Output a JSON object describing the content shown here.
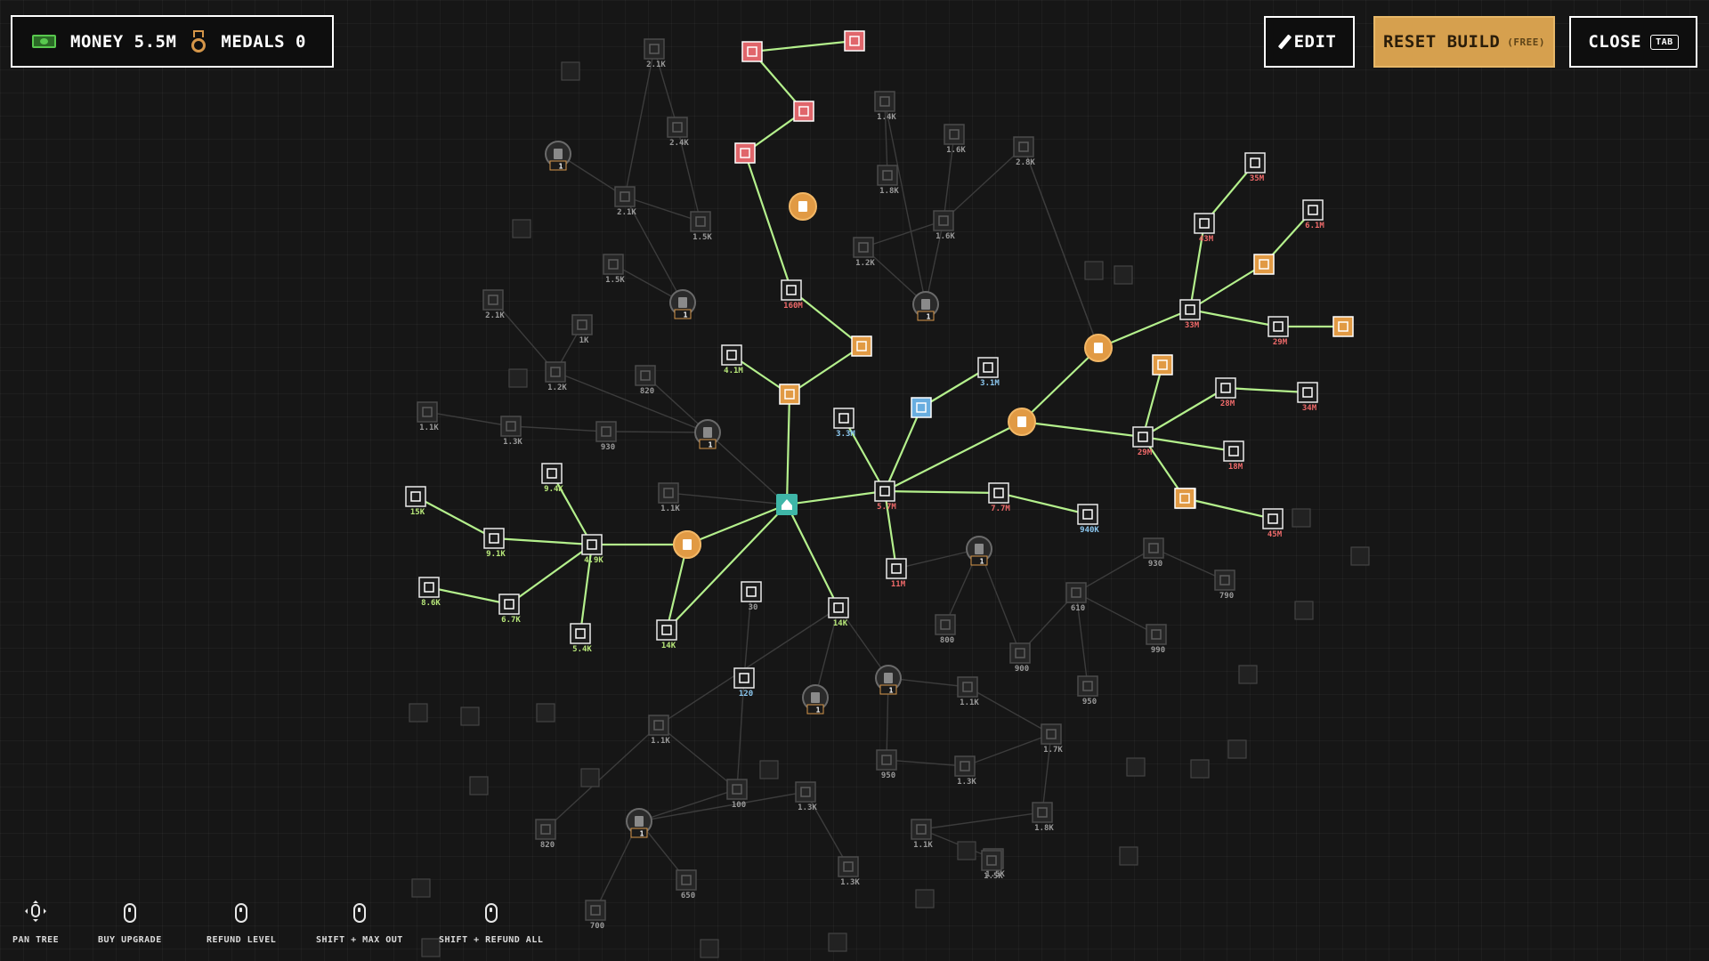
{
  "hud": {
    "money": "MONEY 5.5M",
    "medals": "MEDALS 0"
  },
  "buttons": {
    "edit": "EDIT",
    "reset": "RESET BUILD",
    "reset_sub": "(FREE)",
    "close": "CLOSE",
    "close_key": "TAB"
  },
  "controls": [
    {
      "label": "PAN TREE",
      "icon": "pan-icon"
    },
    {
      "label": "BUY UPGRADE",
      "icon": "mouse-left-icon"
    },
    {
      "label": "REFUND LEVEL",
      "icon": "mouse-right-icon"
    },
    {
      "label": "SHIFT + MAX OUT",
      "icon": "shift-mouse-left-icon"
    },
    {
      "label": "SHIFT + REFUND ALL",
      "icon": "shift-mouse-right-icon"
    }
  ],
  "colors": {
    "edge_active": "#b4f08c",
    "edge_dim": "#3c3c3c",
    "home": "#3fb6a8",
    "white_node": "#eaeaea",
    "orange_node": "#e19a44",
    "red_node": "#e0666b",
    "blue_node": "#69aee0",
    "green_node": "#b7e46c",
    "dim_node": "#4a4a4a"
  },
  "nodes": [
    {
      "id": "home",
      "kind": "home",
      "label": ""
    },
    {
      "id": "b1",
      "kind": "orange",
      "label": ""
    },
    {
      "id": "b2",
      "kind": "orange",
      "label": ""
    },
    {
      "id": "b3",
      "kind": "orange",
      "label": ""
    },
    {
      "id": "b4",
      "kind": "orange",
      "label": ""
    },
    {
      "id": "b5",
      "kind": "orange",
      "label": ""
    },
    {
      "id": "w1",
      "kind": "white",
      "label": "5.7M",
      "tone": "red"
    },
    {
      "id": "w2",
      "kind": "white",
      "label": "3.3M",
      "tone": "blue"
    },
    {
      "id": "w3",
      "kind": "blue",
      "label": ""
    },
    {
      "id": "w4",
      "kind": "white",
      "label": "3.1M",
      "tone": "blue"
    },
    {
      "id": "w5",
      "kind": "white",
      "label": "7.7M",
      "tone": "red"
    },
    {
      "id": "w6",
      "kind": "white",
      "label": "940K",
      "tone": "blue"
    },
    {
      "id": "w7",
      "kind": "white",
      "label": "11M",
      "tone": "red"
    },
    {
      "id": "w8",
      "kind": "white",
      "label": "14K",
      "tone": "green"
    },
    {
      "id": "w9",
      "kind": "orange_sq",
      "label": ""
    },
    {
      "id": "w10",
      "kind": "white",
      "label": "4.1M",
      "tone": "green"
    },
    {
      "id": "w11",
      "kind": "orange_sq",
      "label": ""
    },
    {
      "id": "w12",
      "kind": "white",
      "label": "160M",
      "tone": "red"
    },
    {
      "id": "w13",
      "kind": "red",
      "label": ""
    },
    {
      "id": "w14",
      "kind": "red",
      "label": ""
    },
    {
      "id": "w15",
      "kind": "red",
      "label": ""
    },
    {
      "id": "w16",
      "kind": "red",
      "label": ""
    },
    {
      "id": "w17",
      "kind": "white",
      "label": "29M",
      "tone": "red"
    },
    {
      "id": "w18",
      "kind": "white",
      "label": "28M",
      "tone": "red"
    },
    {
      "id": "w19",
      "kind": "white",
      "label": "34M",
      "tone": "red"
    },
    {
      "id": "w20",
      "kind": "white",
      "label": "18M",
      "tone": "red"
    },
    {
      "id": "w21",
      "kind": "orange_sq",
      "label": ""
    },
    {
      "id": "w22",
      "kind": "white",
      "label": "",
      "tone": ""
    },
    {
      "id": "w23",
      "kind": "white",
      "label": "45M",
      "tone": "red"
    },
    {
      "id": "w24",
      "kind": "white",
      "label": "33M",
      "tone": "red"
    },
    {
      "id": "w25",
      "kind": "white",
      "label": "43M",
      "tone": "red"
    },
    {
      "id": "w26",
      "kind": "white",
      "label": "35M",
      "tone": "red"
    },
    {
      "id": "w27",
      "kind": "orange_sq",
      "label": ""
    },
    {
      "id": "w28",
      "kind": "white",
      "label": "6.1M",
      "tone": "red"
    },
    {
      "id": "w29",
      "kind": "white",
      "label": "29M",
      "tone": "red"
    },
    {
      "id": "w30",
      "kind": "orange_sq",
      "label": ""
    },
    {
      "id": "w31",
      "kind": "orange_sq",
      "label": ""
    },
    {
      "id": "w32",
      "kind": "white",
      "label": "4.9K",
      "tone": "green"
    },
    {
      "id": "w33",
      "kind": "white",
      "label": "9.4K",
      "tone": "green"
    },
    {
      "id": "w34",
      "kind": "white",
      "label": "9.1K",
      "tone": "green"
    },
    {
      "id": "w35",
      "kind": "white",
      "label": "15K",
      "tone": "green"
    },
    {
      "id": "w36",
      "kind": "white",
      "label": "8.6K",
      "tone": "green"
    },
    {
      "id": "w37",
      "kind": "white",
      "label": "6.7K",
      "tone": "green"
    },
    {
      "id": "w38",
      "kind": "white",
      "label": "5.4K",
      "tone": "green"
    },
    {
      "id": "w39",
      "kind": "white",
      "label": "14K",
      "tone": "green"
    },
    {
      "id": "w40",
      "kind": "white",
      "label": "30",
      "tone": "dim"
    },
    {
      "id": "w41",
      "kind": "white",
      "label": "120",
      "tone": "blue"
    },
    {
      "id": "l1",
      "kind": "locked",
      "label": "1"
    },
    {
      "id": "l2",
      "kind": "locked",
      "label": "1"
    },
    {
      "id": "l3",
      "kind": "locked",
      "label": "1"
    },
    {
      "id": "l4",
      "kind": "locked",
      "label": "1"
    },
    {
      "id": "l5",
      "kind": "locked",
      "label": "1"
    },
    {
      "id": "l6",
      "kind": "locked",
      "label": "1"
    },
    {
      "id": "l7",
      "kind": "locked",
      "label": "1"
    },
    {
      "id": "l8",
      "kind": "locked",
      "label": "1"
    },
    {
      "id": "d1",
      "kind": "dim",
      "label": "2.1K"
    },
    {
      "id": "d2",
      "kind": "dim",
      "label": "2.4K"
    },
    {
      "id": "d3",
      "kind": "dim",
      "label": "1.4K"
    },
    {
      "id": "d4",
      "kind": "dim",
      "label": "1.8K"
    },
    {
      "id": "d5",
      "kind": "dim",
      "label": "1.6K"
    },
    {
      "id": "d6",
      "kind": "dim",
      "label": "2.8K"
    },
    {
      "id": "d7",
      "kind": "dim",
      "label": "1.2K"
    },
    {
      "id": "d8",
      "kind": "dim",
      "label": "1.6K"
    },
    {
      "id": "d9",
      "kind": "dim",
      "label": "2.1K"
    },
    {
      "id": "d10",
      "kind": "dim",
      "label": "1.5K"
    },
    {
      "id": "d11",
      "kind": "dim",
      "label": "1.5K"
    },
    {
      "id": "d12",
      "kind": "dim",
      "label": "2.1K"
    },
    {
      "id": "d13",
      "kind": "dim",
      "label": "1K"
    },
    {
      "id": "d14",
      "kind": "dim",
      "label": "1.2K"
    },
    {
      "id": "d15",
      "kind": "dim",
      "label": "820"
    },
    {
      "id": "d16",
      "kind": "dim",
      "label": "1.1K"
    },
    {
      "id": "d17",
      "kind": "dim",
      "label": "1.3K"
    },
    {
      "id": "d18",
      "kind": "dim",
      "label": "930"
    },
    {
      "id": "d19",
      "kind": "dim",
      "label": "1.1K"
    },
    {
      "id": "d20",
      "kind": "dim",
      "label": "800"
    },
    {
      "id": "d21",
      "kind": "dim",
      "label": "900"
    },
    {
      "id": "d22",
      "kind": "dim",
      "label": "610"
    },
    {
      "id": "d23",
      "kind": "dim",
      "label": "950"
    },
    {
      "id": "d24",
      "kind": "dim",
      "label": "990"
    },
    {
      "id": "d25",
      "kind": "dim",
      "label": "930"
    },
    {
      "id": "d26",
      "kind": "dim",
      "label": "790"
    },
    {
      "id": "d27",
      "kind": "dim",
      "label": "1.1K"
    },
    {
      "id": "d28",
      "kind": "dim",
      "label": "1.7K"
    },
    {
      "id": "d29",
      "kind": "dim",
      "label": "1.3K"
    },
    {
      "id": "d30",
      "kind": "dim",
      "label": "950"
    },
    {
      "id": "d31",
      "kind": "dim",
      "label": "1.8K"
    },
    {
      "id": "d32",
      "kind": "dim",
      "label": "1.1K"
    },
    {
      "id": "d33",
      "kind": "dim",
      "label": "1.5K"
    },
    {
      "id": "d34",
      "kind": "dim",
      "label": "1.1K"
    },
    {
      "id": "d35",
      "kind": "dim",
      "label": "100"
    },
    {
      "id": "d36",
      "kind": "dim",
      "label": "1.3K"
    },
    {
      "id": "d37",
      "kind": "dim",
      "label": "1.3K"
    },
    {
      "id": "d38",
      "kind": "dim",
      "label": "1.5K"
    },
    {
      "id": "d39",
      "kind": "dim",
      "label": "820"
    },
    {
      "id": "d40",
      "kind": "dim",
      "label": "650"
    },
    {
      "id": "d41",
      "kind": "dim",
      "label": "700"
    }
  ]
}
